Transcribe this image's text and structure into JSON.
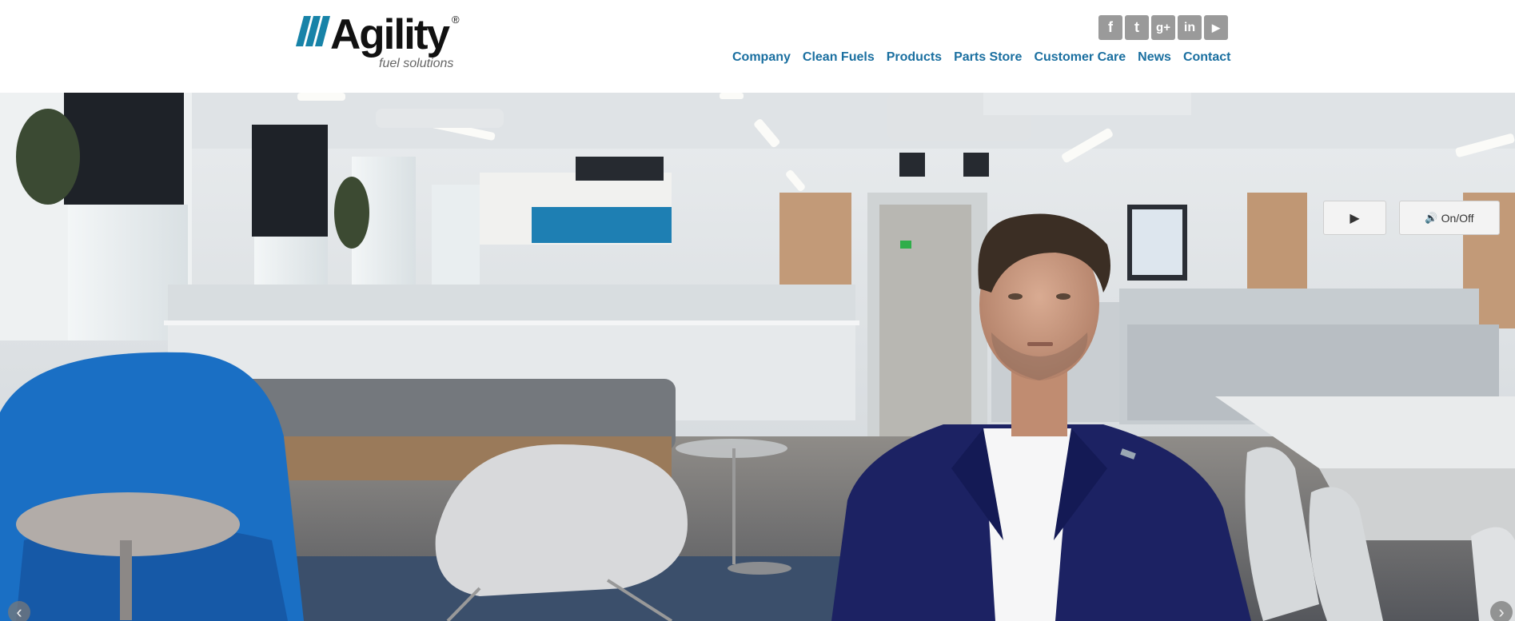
{
  "brand": {
    "name": "Agility",
    "registered": "®",
    "tagline": "fuel solutions"
  },
  "social": [
    {
      "icon": "facebook-icon",
      "glyph": "f"
    },
    {
      "icon": "twitter-icon",
      "glyph": "t"
    },
    {
      "icon": "google-plus-icon",
      "glyph": "g+"
    },
    {
      "icon": "linkedin-icon",
      "glyph": "in"
    },
    {
      "icon": "youtube-icon",
      "glyph": "▶"
    }
  ],
  "nav": {
    "items": [
      {
        "label": "Company"
      },
      {
        "label": "Clean Fuels"
      },
      {
        "label": "Products"
      },
      {
        "label": "Parts Store"
      },
      {
        "label": "Customer Care"
      },
      {
        "label": "News"
      },
      {
        "label": "Contact"
      }
    ]
  },
  "video": {
    "play_glyph": "▶",
    "sound_glyph": "🔊",
    "sound_label": "On/Off"
  },
  "slider": {
    "prev_glyph": "‹",
    "next_glyph": "›"
  },
  "colors": {
    "brand_teal": "#1783a8",
    "nav_link": "#1a6fa0",
    "social_gray": "#9a9a9a"
  }
}
